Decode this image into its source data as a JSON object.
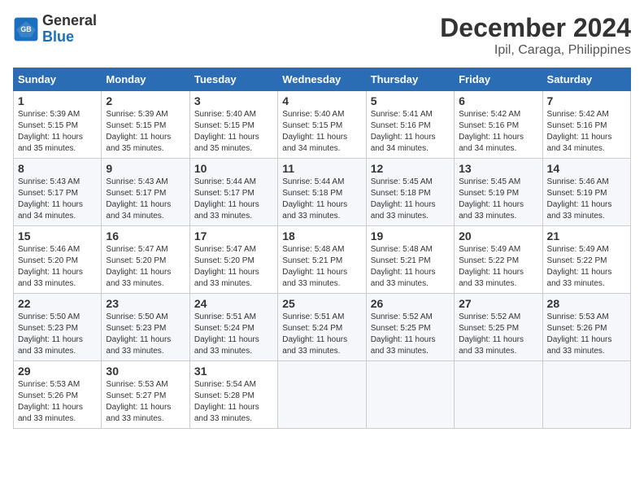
{
  "header": {
    "logo_line1": "General",
    "logo_line2": "Blue",
    "title": "December 2024",
    "subtitle": "Ipil, Caraga, Philippines"
  },
  "calendar": {
    "weekdays": [
      "Sunday",
      "Monday",
      "Tuesday",
      "Wednesday",
      "Thursday",
      "Friday",
      "Saturday"
    ],
    "weeks": [
      [
        {
          "day": "1",
          "info": "Sunrise: 5:39 AM\nSunset: 5:15 PM\nDaylight: 11 hours\nand 35 minutes."
        },
        {
          "day": "2",
          "info": "Sunrise: 5:39 AM\nSunset: 5:15 PM\nDaylight: 11 hours\nand 35 minutes."
        },
        {
          "day": "3",
          "info": "Sunrise: 5:40 AM\nSunset: 5:15 PM\nDaylight: 11 hours\nand 35 minutes."
        },
        {
          "day": "4",
          "info": "Sunrise: 5:40 AM\nSunset: 5:15 PM\nDaylight: 11 hours\nand 34 minutes."
        },
        {
          "day": "5",
          "info": "Sunrise: 5:41 AM\nSunset: 5:16 PM\nDaylight: 11 hours\nand 34 minutes."
        },
        {
          "day": "6",
          "info": "Sunrise: 5:42 AM\nSunset: 5:16 PM\nDaylight: 11 hours\nand 34 minutes."
        },
        {
          "day": "7",
          "info": "Sunrise: 5:42 AM\nSunset: 5:16 PM\nDaylight: 11 hours\nand 34 minutes."
        }
      ],
      [
        {
          "day": "8",
          "info": "Sunrise: 5:43 AM\nSunset: 5:17 PM\nDaylight: 11 hours\nand 34 minutes."
        },
        {
          "day": "9",
          "info": "Sunrise: 5:43 AM\nSunset: 5:17 PM\nDaylight: 11 hours\nand 34 minutes."
        },
        {
          "day": "10",
          "info": "Sunrise: 5:44 AM\nSunset: 5:17 PM\nDaylight: 11 hours\nand 33 minutes."
        },
        {
          "day": "11",
          "info": "Sunrise: 5:44 AM\nSunset: 5:18 PM\nDaylight: 11 hours\nand 33 minutes."
        },
        {
          "day": "12",
          "info": "Sunrise: 5:45 AM\nSunset: 5:18 PM\nDaylight: 11 hours\nand 33 minutes."
        },
        {
          "day": "13",
          "info": "Sunrise: 5:45 AM\nSunset: 5:19 PM\nDaylight: 11 hours\nand 33 minutes."
        },
        {
          "day": "14",
          "info": "Sunrise: 5:46 AM\nSunset: 5:19 PM\nDaylight: 11 hours\nand 33 minutes."
        }
      ],
      [
        {
          "day": "15",
          "info": "Sunrise: 5:46 AM\nSunset: 5:20 PM\nDaylight: 11 hours\nand 33 minutes."
        },
        {
          "day": "16",
          "info": "Sunrise: 5:47 AM\nSunset: 5:20 PM\nDaylight: 11 hours\nand 33 minutes."
        },
        {
          "day": "17",
          "info": "Sunrise: 5:47 AM\nSunset: 5:20 PM\nDaylight: 11 hours\nand 33 minutes."
        },
        {
          "day": "18",
          "info": "Sunrise: 5:48 AM\nSunset: 5:21 PM\nDaylight: 11 hours\nand 33 minutes."
        },
        {
          "day": "19",
          "info": "Sunrise: 5:48 AM\nSunset: 5:21 PM\nDaylight: 11 hours\nand 33 minutes."
        },
        {
          "day": "20",
          "info": "Sunrise: 5:49 AM\nSunset: 5:22 PM\nDaylight: 11 hours\nand 33 minutes."
        },
        {
          "day": "21",
          "info": "Sunrise: 5:49 AM\nSunset: 5:22 PM\nDaylight: 11 hours\nand 33 minutes."
        }
      ],
      [
        {
          "day": "22",
          "info": "Sunrise: 5:50 AM\nSunset: 5:23 PM\nDaylight: 11 hours\nand 33 minutes."
        },
        {
          "day": "23",
          "info": "Sunrise: 5:50 AM\nSunset: 5:23 PM\nDaylight: 11 hours\nand 33 minutes."
        },
        {
          "day": "24",
          "info": "Sunrise: 5:51 AM\nSunset: 5:24 PM\nDaylight: 11 hours\nand 33 minutes."
        },
        {
          "day": "25",
          "info": "Sunrise: 5:51 AM\nSunset: 5:24 PM\nDaylight: 11 hours\nand 33 minutes."
        },
        {
          "day": "26",
          "info": "Sunrise: 5:52 AM\nSunset: 5:25 PM\nDaylight: 11 hours\nand 33 minutes."
        },
        {
          "day": "27",
          "info": "Sunrise: 5:52 AM\nSunset: 5:25 PM\nDaylight: 11 hours\nand 33 minutes."
        },
        {
          "day": "28",
          "info": "Sunrise: 5:53 AM\nSunset: 5:26 PM\nDaylight: 11 hours\nand 33 minutes."
        }
      ],
      [
        {
          "day": "29",
          "info": "Sunrise: 5:53 AM\nSunset: 5:26 PM\nDaylight: 11 hours\nand 33 minutes."
        },
        {
          "day": "30",
          "info": "Sunrise: 5:53 AM\nSunset: 5:27 PM\nDaylight: 11 hours\nand 33 minutes."
        },
        {
          "day": "31",
          "info": "Sunrise: 5:54 AM\nSunset: 5:28 PM\nDaylight: 11 hours\nand 33 minutes."
        },
        {
          "day": "",
          "info": ""
        },
        {
          "day": "",
          "info": ""
        },
        {
          "day": "",
          "info": ""
        },
        {
          "day": "",
          "info": ""
        }
      ]
    ]
  }
}
